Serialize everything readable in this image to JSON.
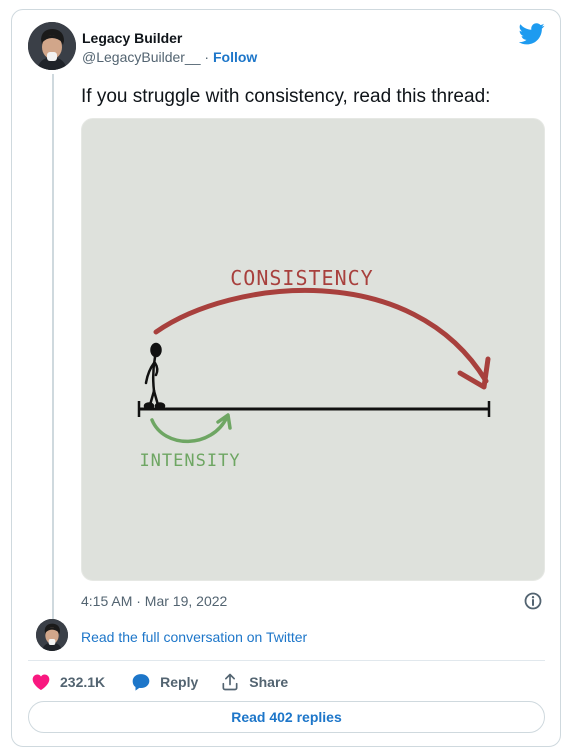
{
  "author": {
    "name": "Legacy Builder",
    "handle": "@LegacyBuilder__",
    "separator": "·",
    "follow_label": "Follow"
  },
  "tweet": {
    "text": "If you struggle with consistency, read this thread:",
    "timestamp": "4:15 AM · Mar 19, 2022"
  },
  "media": {
    "label_top": "CONSISTENCY",
    "label_bottom": "INTENSITY",
    "colors": {
      "background": "#dee1dc",
      "consistency": "#a8403d",
      "intensity": "#6ea663",
      "line": "#111111"
    }
  },
  "conversation": {
    "link_label": "Read the full conversation on Twitter"
  },
  "actions": {
    "likes": "232.1K",
    "reply_label": "Reply",
    "share_label": "Share"
  },
  "replies_button": "Read 402 replies",
  "colors": {
    "accent": "#1d76c9",
    "twitter_blue": "#1d9bf0",
    "heart": "#f91880",
    "muted": "#536471"
  }
}
